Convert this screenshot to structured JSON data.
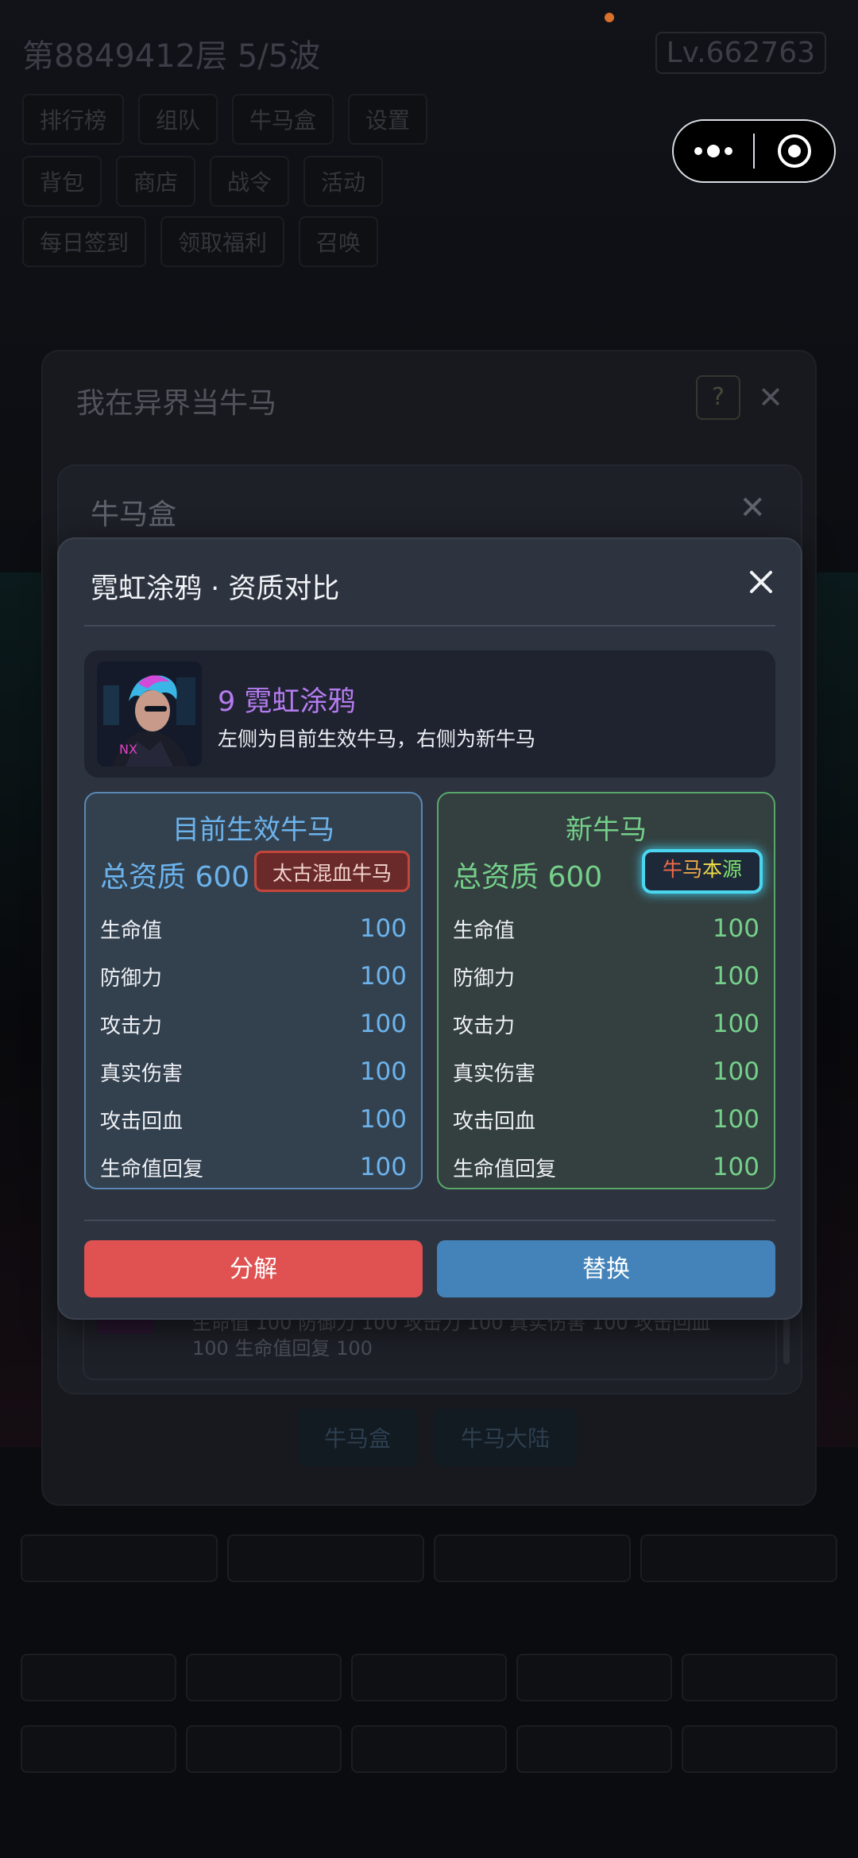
{
  "background": {
    "title": "第8849412层  5/5波",
    "level": "Lv.662763",
    "row1": [
      "排行榜",
      "组队",
      "牛马盒",
      "设置"
    ],
    "row2": [
      "背包",
      "商店",
      "战令",
      "活动"
    ],
    "row3": [
      "每日签到",
      "领取福利",
      "召唤"
    ],
    "bottom1": [
      "",
      "",
      "",
      "",
      ""
    ],
    "bottom2": [
      "",
      "",
      "",
      "",
      ""
    ]
  },
  "outer_dialog": {
    "title": "我在异界当牛马",
    "help": "?",
    "tabs": [
      "牛马盒",
      "牛马大陆"
    ]
  },
  "middle_dialog": {
    "title": "牛马盒",
    "item_stats": "生命值 100  防御力 100  攻击力 100  真实伤害 100  攻击回血 100  生命值回复 100"
  },
  "compare_dialog": {
    "title": "霓虹涂鸦 · 资质对比",
    "pet": {
      "name": "9  霓虹涂鸦",
      "description": "左侧为目前生效牛马，右侧为新牛马"
    },
    "left": {
      "heading": "目前生效牛马",
      "total": "总资质 600",
      "badge": "太古混血牛马",
      "stats": [
        {
          "label": "生命值",
          "value": "100"
        },
        {
          "label": "防御力",
          "value": "100"
        },
        {
          "label": "攻击力",
          "value": "100"
        },
        {
          "label": "真实伤害",
          "value": "100"
        },
        {
          "label": "攻击回血",
          "value": "100"
        },
        {
          "label": "生命值回复",
          "value": "100"
        }
      ]
    },
    "right": {
      "heading": "新牛马",
      "total": "总资质 600",
      "badge_chars": [
        "牛",
        "马",
        "本",
        "源"
      ],
      "badge_colors": [
        "#f06a4a",
        "#f0a94a",
        "#f0df4a",
        "#7ee070"
      ],
      "stats": [
        {
          "label": "生命值",
          "value": "100"
        },
        {
          "label": "防御力",
          "value": "100"
        },
        {
          "label": "攻击力",
          "value": "100"
        },
        {
          "label": "真实伤害",
          "value": "100"
        },
        {
          "label": "攻击回血",
          "value": "100"
        },
        {
          "label": "生命值回复",
          "value": "100"
        }
      ]
    },
    "buttons": {
      "decompose": "分解",
      "replace": "替换"
    }
  },
  "colors": {
    "left_accent": "#6cb3ec",
    "right_accent": "#74d08a",
    "pet_name": "#b57cf0",
    "decompose_button": "#e05252",
    "replace_button": "#4383b9"
  }
}
